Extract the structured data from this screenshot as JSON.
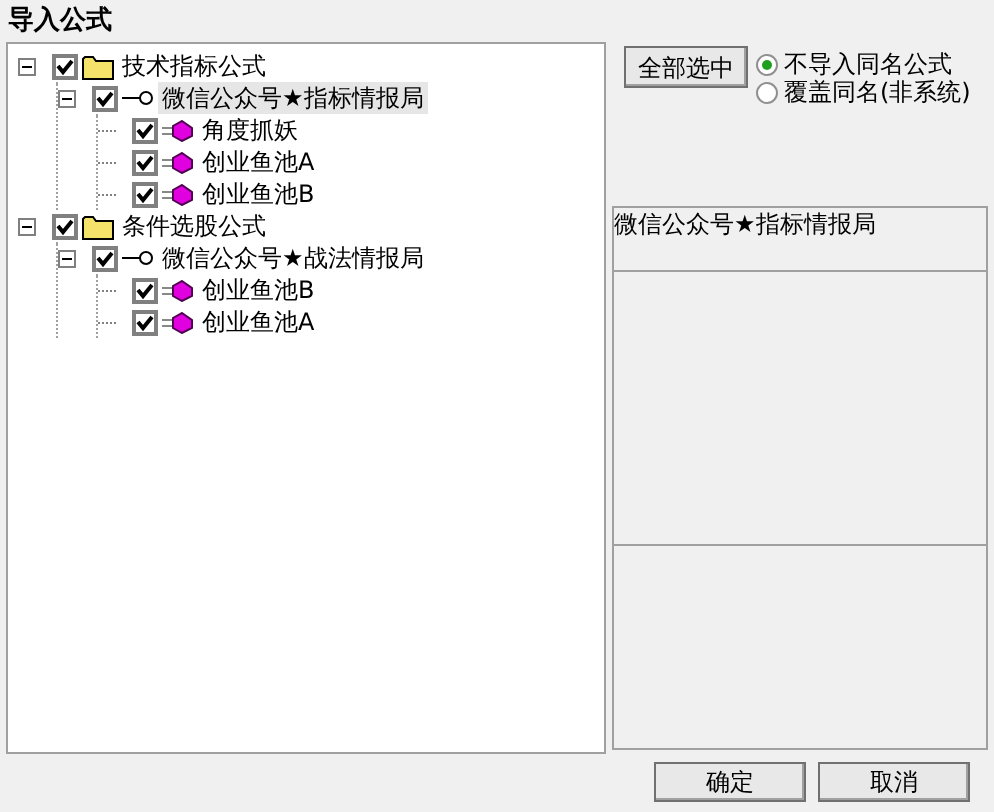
{
  "window": {
    "title": "导入公式"
  },
  "tree": [
    {
      "kind": "folder",
      "label": "技术指标公式",
      "checked": true,
      "expanded": true,
      "selected": false,
      "children": [
        {
          "kind": "group",
          "label": "微信公众号★指标情报局",
          "checked": true,
          "expanded": true,
          "selected": true,
          "children": [
            {
              "kind": "formula",
              "label": "角度抓妖",
              "checked": true,
              "selected": false
            },
            {
              "kind": "formula",
              "label": "创业鱼池A",
              "checked": true,
              "selected": false
            },
            {
              "kind": "formula",
              "label": "创业鱼池B",
              "checked": true,
              "selected": false
            }
          ]
        }
      ]
    },
    {
      "kind": "folder",
      "label": "条件选股公式",
      "checked": true,
      "expanded": true,
      "selected": false,
      "children": [
        {
          "kind": "group",
          "label": "微信公众号★战法情报局",
          "checked": true,
          "expanded": true,
          "selected": false,
          "children": [
            {
              "kind": "formula",
              "label": "创业鱼池B",
              "checked": true,
              "selected": false
            },
            {
              "kind": "formula",
              "label": "创业鱼池A",
              "checked": true,
              "selected": false
            }
          ]
        }
      ]
    }
  ],
  "select_all_button": "全部选中",
  "options": [
    {
      "label": "不导入同名公式",
      "selected": true
    },
    {
      "label": "覆盖同名(非系统)",
      "selected": false
    }
  ],
  "description": "微信公众号★指标情报局",
  "buttons": [
    "确定",
    "取消"
  ]
}
